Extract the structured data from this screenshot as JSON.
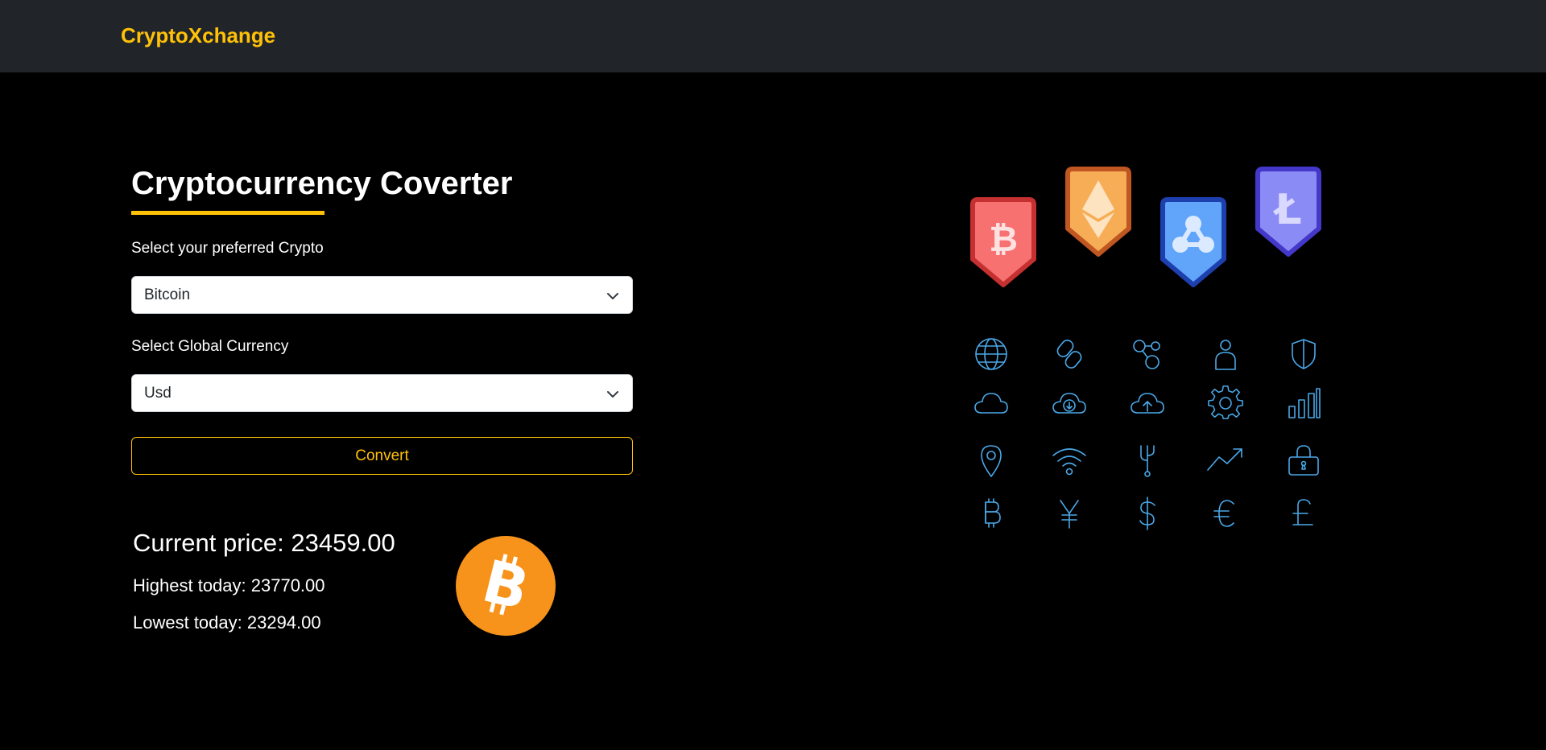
{
  "navbar": {
    "brand": "CryptoXchange"
  },
  "converter": {
    "title": "Cryptocurrency Coverter",
    "crypto_label": "Select your preferred Crypto",
    "crypto_selected": "Bitcoin",
    "currency_label": "Select Global Currency",
    "currency_selected": "Usd",
    "convert_label": "Convert"
  },
  "prices": {
    "current": "Current price: 23459.00",
    "highest": "Highest today: 23770.00",
    "lowest": "Lowest today: 23294.00"
  },
  "coin_logo": {
    "icon": "bitcoin-logo-icon",
    "color": "#f7931a",
    "glyph": "₿"
  },
  "badges": [
    {
      "name": "bitcoin-badge-icon",
      "glyph": "₿",
      "fill": "#f87171",
      "stroke": "#c53030"
    },
    {
      "name": "ethereum-badge-icon",
      "glyph": "◆",
      "fill": "#f6ad55",
      "stroke": "#c05621"
    },
    {
      "name": "ripple-badge-icon",
      "glyph": "✢",
      "fill": "#60a5fa",
      "stroke": "#1e40af"
    },
    {
      "name": "litecoin-badge-icon",
      "glyph": "Ł",
      "fill": "#8b8bf5",
      "stroke": "#4338ca"
    }
  ],
  "icon_grid": [
    "globe-icon",
    "link-icon",
    "network-icon",
    "user-icon",
    "shield-icon",
    "cloud-icon",
    "cloud-download-icon",
    "cloud-upload-icon",
    "gear-icon",
    "bar-chart-icon",
    "location-pin-icon",
    "wifi-icon",
    "usb-icon",
    "trend-up-icon",
    "lock-icon",
    "bitcoin-icon",
    "yen-icon",
    "dollar-icon",
    "euro-icon",
    "pound-icon"
  ],
  "colors": {
    "accent": "#ffc107",
    "navbar_bg": "#212529",
    "page_bg": "#000000",
    "icon_line": "#4aa8e8"
  }
}
